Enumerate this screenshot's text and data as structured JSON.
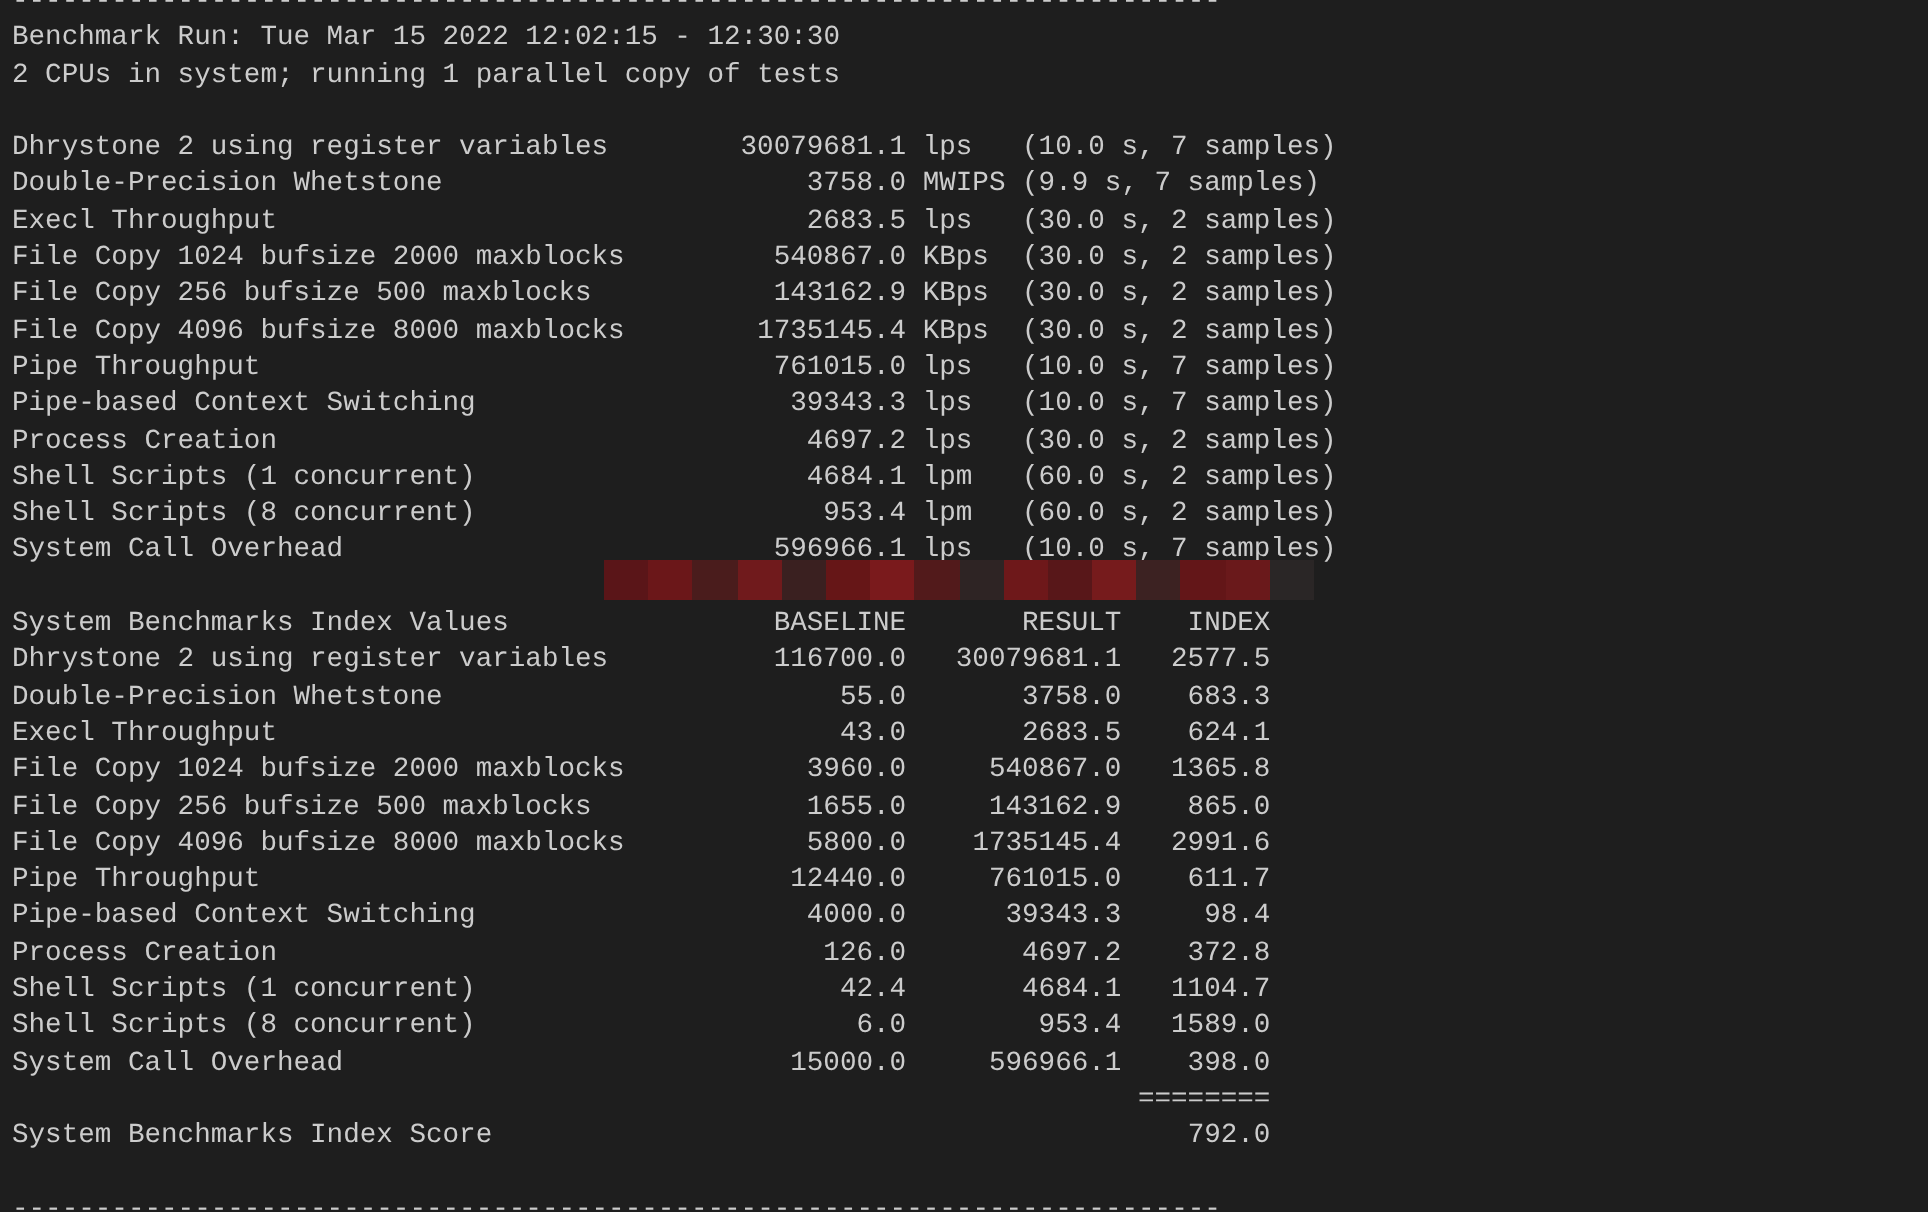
{
  "separator_top": "-------------------------------------------------------------------------",
  "header": {
    "run": "Benchmark Run: Tue Mar 15 2022 12:02:15 - 12:30:30",
    "cpus": "2 CPUs in system; running 1 parallel copy of tests"
  },
  "results": [
    {
      "test": "Dhrystone 2 using register variables",
      "value": "30079681.1",
      "unit": "lps",
      "detail": "(10.0 s, 7 samples)"
    },
    {
      "test": "Double-Precision Whetstone",
      "value": "3758.0",
      "unit": "MWIPS",
      "detail": "(9.9 s, 7 samples)"
    },
    {
      "test": "Execl Throughput",
      "value": "2683.5",
      "unit": "lps",
      "detail": "(30.0 s, 2 samples)"
    },
    {
      "test": "File Copy 1024 bufsize 2000 maxblocks",
      "value": "540867.0",
      "unit": "KBps",
      "detail": "(30.0 s, 2 samples)"
    },
    {
      "test": "File Copy 256 bufsize 500 maxblocks",
      "value": "143162.9",
      "unit": "KBps",
      "detail": "(30.0 s, 2 samples)"
    },
    {
      "test": "File Copy 4096 bufsize 8000 maxblocks",
      "value": "1735145.4",
      "unit": "KBps",
      "detail": "(30.0 s, 2 samples)"
    },
    {
      "test": "Pipe Throughput",
      "value": "761015.0",
      "unit": "lps",
      "detail": "(10.0 s, 7 samples)"
    },
    {
      "test": "Pipe-based Context Switching",
      "value": "39343.3",
      "unit": "lps",
      "detail": "(10.0 s, 7 samples)"
    },
    {
      "test": "Process Creation",
      "value": "4697.2",
      "unit": "lps",
      "detail": "(30.0 s, 2 samples)"
    },
    {
      "test": "Shell Scripts (1 concurrent)",
      "value": "4684.1",
      "unit": "lpm",
      "detail": "(60.0 s, 2 samples)"
    },
    {
      "test": "Shell Scripts (8 concurrent)",
      "value": "953.4",
      "unit": "lpm",
      "detail": "(60.0 s, 2 samples)"
    },
    {
      "test": "System Call Overhead",
      "value": "596966.1",
      "unit": "lps",
      "detail": "(10.0 s, 7 samples)"
    }
  ],
  "index_table": {
    "columns": [
      "System Benchmarks Index Values",
      "BASELINE",
      "RESULT",
      "INDEX"
    ],
    "rows": [
      {
        "test": "Dhrystone 2 using register variables",
        "baseline": "116700.0",
        "result": "30079681.1",
        "index": "2577.5"
      },
      {
        "test": "Double-Precision Whetstone",
        "baseline": "55.0",
        "result": "3758.0",
        "index": "683.3"
      },
      {
        "test": "Execl Throughput",
        "baseline": "43.0",
        "result": "2683.5",
        "index": "624.1"
      },
      {
        "test": "File Copy 1024 bufsize 2000 maxblocks",
        "baseline": "3960.0",
        "result": "540867.0",
        "index": "1365.8"
      },
      {
        "test": "File Copy 256 bufsize 500 maxblocks",
        "baseline": "1655.0",
        "result": "143162.9",
        "index": "865.0"
      },
      {
        "test": "File Copy 4096 bufsize 8000 maxblocks",
        "baseline": "5800.0",
        "result": "1735145.4",
        "index": "2991.6"
      },
      {
        "test": "Pipe Throughput",
        "baseline": "12440.0",
        "result": "761015.0",
        "index": "611.7"
      },
      {
        "test": "Pipe-based Context Switching",
        "baseline": "4000.0",
        "result": "39343.3",
        "index": "98.4"
      },
      {
        "test": "Process Creation",
        "baseline": "126.0",
        "result": "4697.2",
        "index": "372.8"
      },
      {
        "test": "Shell Scripts (1 concurrent)",
        "baseline": "42.4",
        "result": "4684.1",
        "index": "1104.7"
      },
      {
        "test": "Shell Scripts (8 concurrent)",
        "baseline": "6.0",
        "result": "953.4",
        "index": "1589.0"
      },
      {
        "test": "System Call Overhead",
        "baseline": "15000.0",
        "result": "596966.1",
        "index": "398.0"
      }
    ],
    "total_rule": "========",
    "score": {
      "label": "System Benchmarks Index Score",
      "value": "792.0"
    }
  },
  "separator_bottom": "-------------------------------------------------------------------------"
}
